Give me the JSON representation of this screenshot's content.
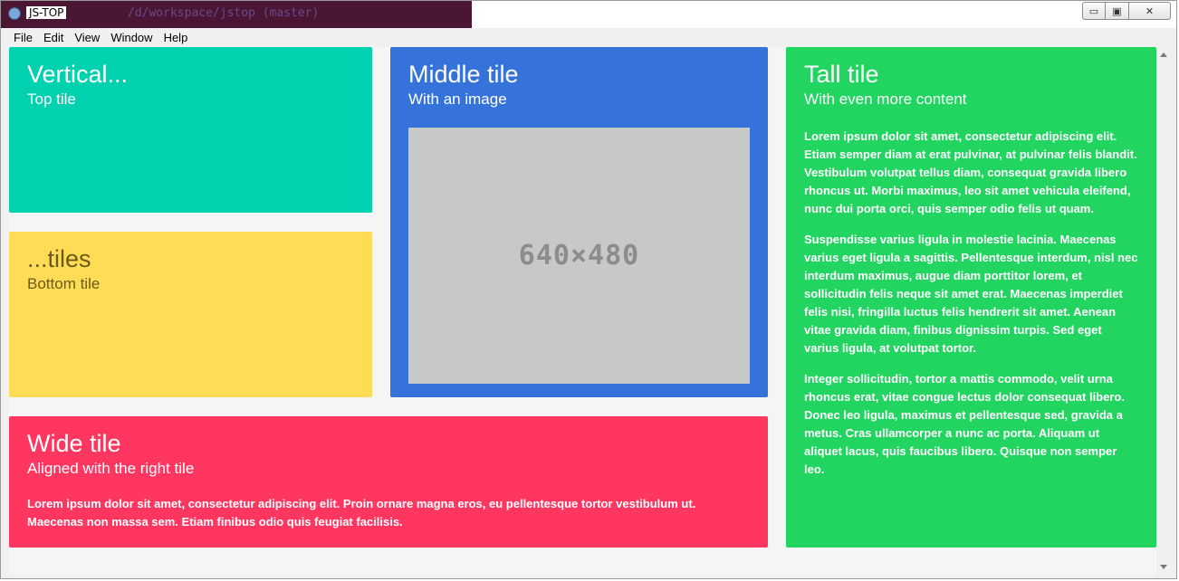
{
  "window": {
    "title": "JS-TOP",
    "background_terminal_text": "/d/workspace/jstop (master)",
    "controls": {
      "minimize": "▭",
      "maximize": "▣",
      "close": "✕"
    }
  },
  "menu": [
    "File",
    "Edit",
    "View",
    "Window",
    "Help"
  ],
  "tiles": {
    "top": {
      "title": "Vertical...",
      "subtitle": "Top tile"
    },
    "bottom": {
      "title": "...tiles",
      "subtitle": "Bottom tile"
    },
    "middle": {
      "title": "Middle tile",
      "subtitle": "With an image",
      "image_label": "640×480"
    },
    "wide": {
      "title": "Wide tile",
      "subtitle": "Aligned with the right tile",
      "text": "Lorem ipsum dolor sit amet, consectetur adipiscing elit. Proin ornare magna eros, eu pellentesque tortor vestibulum ut. Maecenas non massa sem. Etiam finibus odio quis feugiat facilisis."
    },
    "tall": {
      "title": "Tall tile",
      "subtitle": "With even more content",
      "paragraphs": [
        "Lorem ipsum dolor sit amet, consectetur adipiscing elit. Etiam semper diam at erat pulvinar, at pulvinar felis blandit. Vestibulum volutpat tellus diam, consequat gravida libero rhoncus ut. Morbi maximus, leo sit amet vehicula eleifend, nunc dui porta orci, quis semper odio felis ut quam.",
        "Suspendisse varius ligula in molestie lacinia. Maecenas varius eget ligula a sagittis. Pellentesque interdum, nisl nec interdum maximus, augue diam porttitor lorem, et sollicitudin felis neque sit amet erat. Maecenas imperdiet felis nisi, fringilla luctus felis hendrerit sit amet. Aenean vitae gravida diam, finibus dignissim turpis. Sed eget varius ligula, at volutpat tortor.",
        "Integer sollicitudin, tortor a mattis commodo, velit urna rhoncus erat, vitae congue lectus dolor consequat libero. Donec leo ligula, maximus et pellentesque sed, gravida a metus. Cras ullamcorper a nunc ac porta. Aliquam ut aliquet lacus, quis faucibus libero. Quisque non semper leo."
      ]
    }
  },
  "colors": {
    "top": "#00d2b0",
    "bottom": "#ffdc55",
    "middle": "#3573db",
    "wide": "#ff3660",
    "tall": "#22d460",
    "placeholder": "#c8c8c8"
  }
}
